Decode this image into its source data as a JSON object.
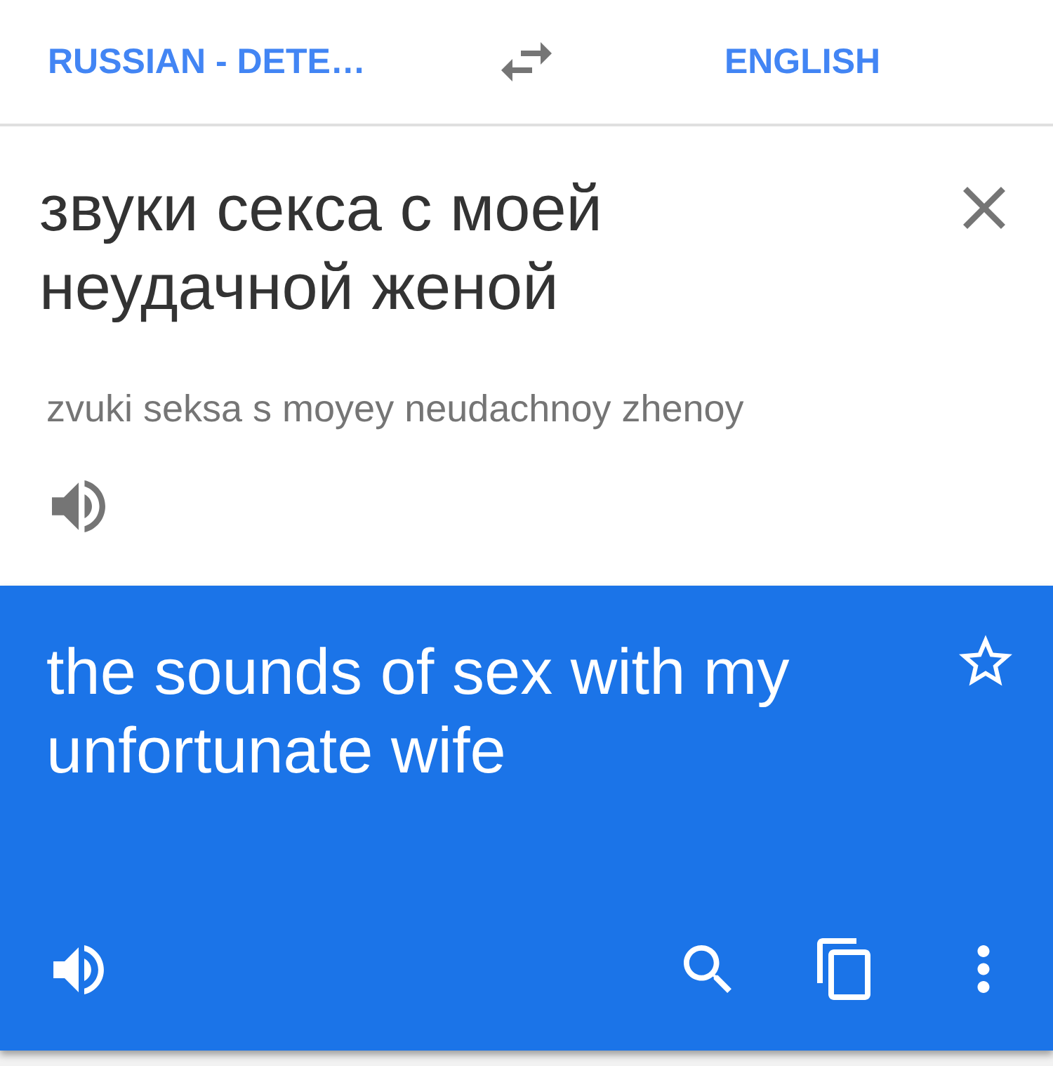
{
  "header": {
    "source_language": "RUSSIAN - DETE…",
    "target_language": "ENGLISH"
  },
  "source": {
    "text": "звуки секса с моей неудачной женой",
    "transliteration": "zvuki seksa s moyey neudachnoy zhenoy"
  },
  "translation": {
    "text": "the sounds of sex with my unfortunate wife",
    "starred": false
  }
}
